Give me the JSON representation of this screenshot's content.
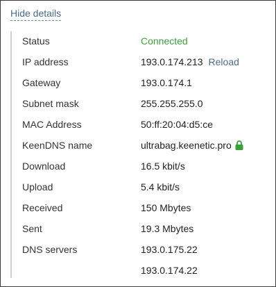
{
  "toggle": {
    "label": "Hide details"
  },
  "details": {
    "status": {
      "label": "Status",
      "value": "Connected",
      "color": "#3aa03a"
    },
    "ip": {
      "label": "IP address",
      "value": "193.0.174.213",
      "action": "Reload"
    },
    "gateway": {
      "label": "Gateway",
      "value": "193.0.174.1"
    },
    "subnet": {
      "label": "Subnet mask",
      "value": "255.255.255.0"
    },
    "mac": {
      "label": "MAC Address",
      "value": "50:ff:20:04:d5:ce"
    },
    "keendns": {
      "label": "KeenDNS name",
      "value": "ultrabag.keenetic.pro",
      "icon": "lock-icon"
    },
    "download": {
      "label": "Download",
      "value": "16.5 kbit/s"
    },
    "upload": {
      "label": "Upload",
      "value": "5.4 kbit/s"
    },
    "received": {
      "label": "Received",
      "value": "150 Mbytes"
    },
    "sent": {
      "label": "Sent",
      "value": "19.3 Mbytes"
    },
    "dns": {
      "label": "DNS servers",
      "values": [
        "193.0.175.22",
        "193.0.174.22"
      ]
    }
  }
}
